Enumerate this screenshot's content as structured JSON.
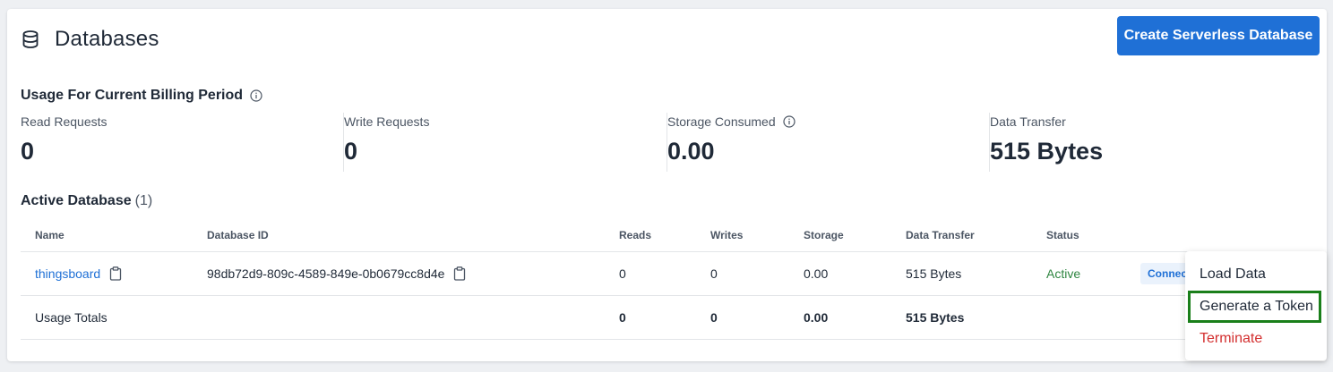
{
  "header": {
    "title": "Databases",
    "create_button": "Create Serverless Database",
    "icon": "database-icon"
  },
  "usage": {
    "title": "Usage For Current Billing Period",
    "metrics": [
      {
        "label": "Read Requests",
        "value": "0"
      },
      {
        "label": "Write Requests",
        "value": "0"
      },
      {
        "label": "Storage Consumed",
        "value": "0.00"
      },
      {
        "label": "Data Transfer",
        "value": "515 Bytes"
      }
    ]
  },
  "active": {
    "title": "Active Database",
    "count": "(1)"
  },
  "table": {
    "columns": [
      "Name",
      "Database ID",
      "Reads",
      "Writes",
      "Storage",
      "Data Transfer",
      "Status"
    ],
    "rows": [
      {
        "name": "thingsboard",
        "id": "98db72d9-809c-4589-849e-0b0679cc8d4e",
        "reads": "0",
        "writes": "0",
        "storage": "0.00",
        "transfer": "515 Bytes",
        "status": "Active",
        "action": "Connect"
      }
    ],
    "totals": {
      "label": "Usage Totals",
      "reads": "0",
      "writes": "0",
      "storage": "0.00",
      "transfer": "515 Bytes"
    }
  },
  "menu": {
    "items": [
      "Load Data",
      "Generate a Token",
      "Terminate"
    ]
  },
  "colors": {
    "primary": "#1f70d6",
    "active": "#2e8540",
    "danger": "#d32f2f",
    "focus": "#1a7f1a"
  }
}
